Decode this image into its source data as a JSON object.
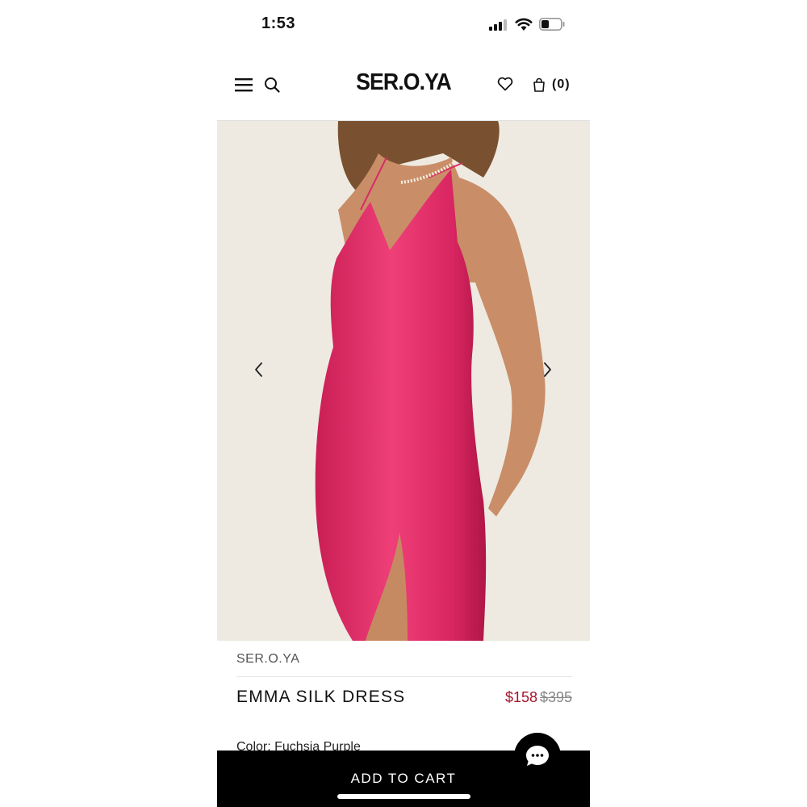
{
  "status_bar": {
    "time": "1:53"
  },
  "header": {
    "brand": "SER.O.YA",
    "cart_count": "(0)"
  },
  "product": {
    "brand": "SER.O.YA",
    "name": "EMMA SILK DRESS",
    "sale_price": "$158",
    "original_price": "$395",
    "color_label": "Color: Fuchsia Purple"
  },
  "actions": {
    "add_to_cart": "ADD TO CART"
  },
  "colors": {
    "accent_sale": "#a3142b",
    "dress": "#e8336e",
    "cta_background": "#000000"
  },
  "icons": [
    "menu-icon",
    "search-icon",
    "heart-icon",
    "shopping-bag-icon",
    "chevron-left-icon",
    "chevron-right-icon",
    "chat-icon"
  ]
}
